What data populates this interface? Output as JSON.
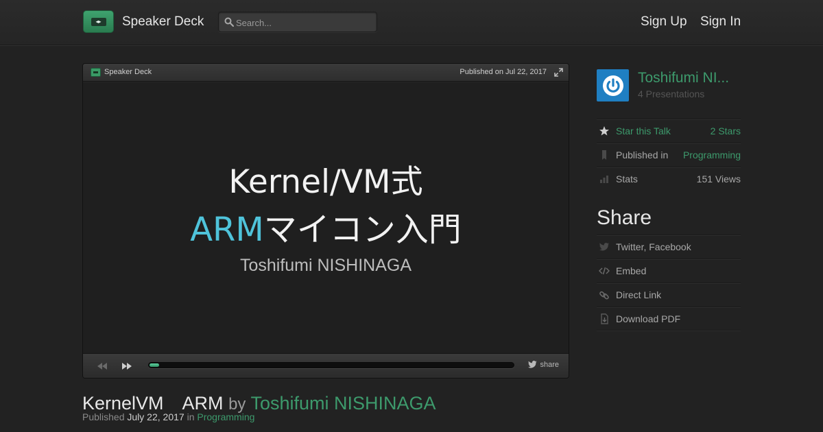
{
  "header": {
    "brand": "Speaker Deck",
    "search_placeholder": "Search...",
    "sign_up": "Sign Up",
    "sign_in": "Sign In"
  },
  "player": {
    "brand": "Speaker Deck",
    "published": "Published on Jul 22, 2017",
    "slide": {
      "line1": "Kernel/VM式",
      "line2_accent": "ARM",
      "line2_rest": "マイコン入門",
      "line3": "Toshifumi NISHINAGA"
    },
    "progress": 0.02,
    "share_label": "share"
  },
  "talk": {
    "title": "KernelVM　ARM",
    "by": "by",
    "author": "Toshifumi NISHINAGA",
    "published_label": "Published",
    "published_date": "July 22, 2017",
    "in_label": "in",
    "category": "Programming"
  },
  "sidebar": {
    "author_name": "Toshifumi NI...",
    "author_count": "4 Presentations",
    "stats": [
      {
        "icon": "star-icon",
        "label": "Star this Talk",
        "value": "2 Stars"
      },
      {
        "icon": "bookmark-icon",
        "label": "Published in",
        "value": "Programming"
      },
      {
        "icon": "bar-chart-icon",
        "label": "Stats",
        "value": "151 Views"
      }
    ],
    "share_heading": "Share",
    "share_items": [
      {
        "icon": "twitter-icon",
        "label": "Twitter, Facebook"
      },
      {
        "icon": "code-icon",
        "label": "Embed"
      },
      {
        "icon": "link-icon",
        "label": "Direct Link"
      },
      {
        "icon": "download-icon",
        "label": "Download PDF"
      }
    ]
  },
  "colors": {
    "accent_green": "#3d9a6c",
    "slide_accent": "#4fc3da",
    "avatar_blue": "#1f7fc2"
  }
}
